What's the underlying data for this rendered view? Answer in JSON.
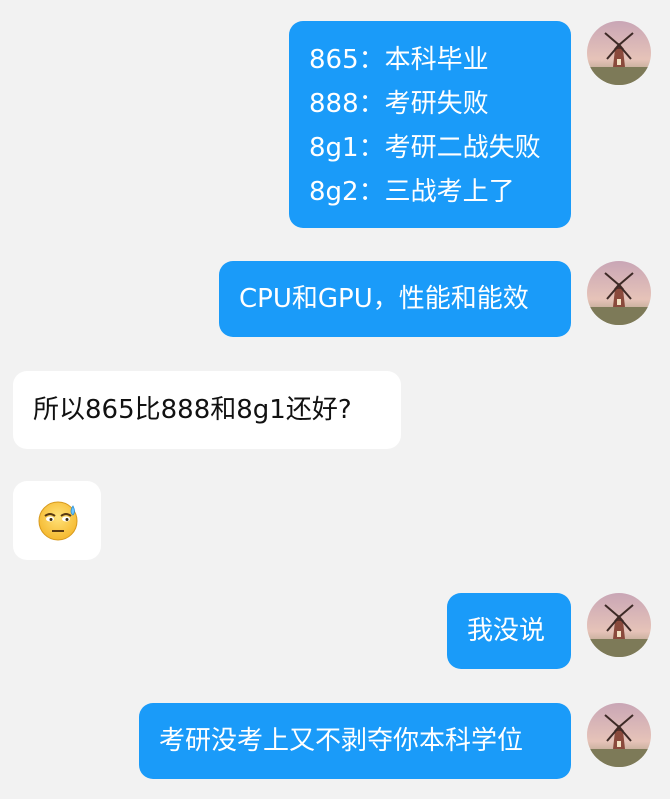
{
  "messages": [
    {
      "side": "right",
      "lines": [
        "865：本科毕业",
        "888：考研失败",
        "8g1：考研二战失败",
        "8g2：三战考上了"
      ]
    },
    {
      "side": "right",
      "lines": [
        "CPU和GPU，性能和能效"
      ]
    },
    {
      "side": "left",
      "lines": [
        "所以865比888和8g1还好?"
      ]
    },
    {
      "side": "left",
      "emoji": "sweat-emoji-icon"
    },
    {
      "side": "right",
      "lines": [
        "我没说"
      ]
    },
    {
      "side": "right",
      "lines": [
        "考研没考上又不剥夺你本科学位"
      ]
    }
  ],
  "colors": {
    "sent_bubble": "#1a9bf9",
    "received_bubble": "#ffffff",
    "background": "#f2f2f2"
  },
  "avatar": {
    "icon": "windmill-avatar-icon"
  }
}
